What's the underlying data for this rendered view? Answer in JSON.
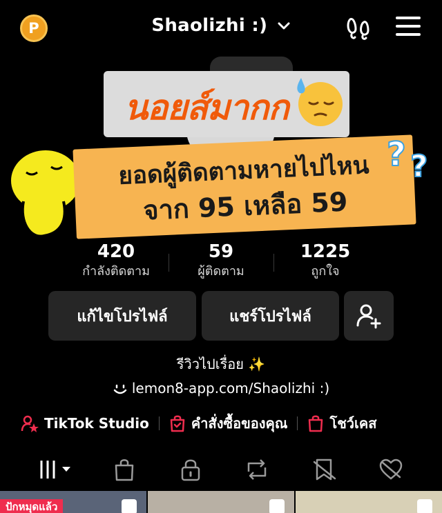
{
  "header": {
    "coin_label": "P",
    "username": "Shaolizhi :)"
  },
  "cover": {
    "sticker_text": "นอยส์มากก",
    "banner_line1": "ยอดผู้ติดตามหายไปไหน",
    "banner_line2": "จาก 95 เหลือ 59"
  },
  "stats": [
    {
      "value": "420",
      "label": "กำลังติดตาม"
    },
    {
      "value": "59",
      "label": "ผู้ติดตาม"
    },
    {
      "value": "1225",
      "label": "ถูกใจ"
    }
  ],
  "buttons": {
    "edit_profile": "แก้ไขโปรไฟล์",
    "share_profile": "แชร์โปรไฟล์"
  },
  "bio": {
    "text": "รีวิวไปเรื่อย ✨",
    "link": "lemon8-app.com/Shaolizhi :)"
  },
  "actions": [
    {
      "label": "TikTok Studio",
      "icon": "person-star-icon"
    },
    {
      "label": "คำสั่งซื้อของคุณ",
      "icon": "shopping-bag-check-icon"
    },
    {
      "label": "โชว์เคส",
      "icon": "shopping-bag-icon"
    }
  ],
  "tabs": [
    "grid-icon",
    "shop-bag-icon",
    "lock-icon",
    "repost-icon",
    "favorites-icon",
    "liked-icon"
  ],
  "grid": {
    "pinned_badge": "ปักหมุดแล้ว"
  },
  "colors": {
    "accent": "#ef2d4e",
    "background": "#000000",
    "button_bg": "#262626",
    "banner": "#f7b451",
    "sticker_text": "#f05a0a"
  }
}
